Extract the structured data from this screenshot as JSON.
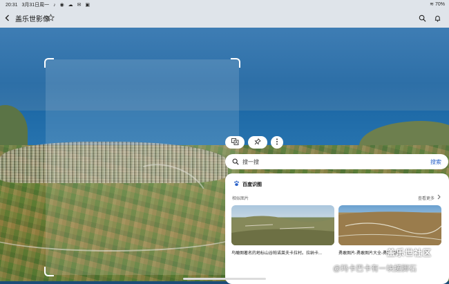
{
  "status_bar": {
    "time": "20:31",
    "date": "3月31日周一",
    "notification_icons": [
      "tiktok-icon",
      "bell-icon",
      "cloud-icon",
      "mail-icon",
      "media-icon"
    ],
    "battery": "70%"
  },
  "app_bar": {
    "title": "盖乐世影像"
  },
  "actions": {
    "icons": [
      "translate-icon",
      "pin-icon",
      "more-vert-icon"
    ]
  },
  "search": {
    "placeholder": "搜一搜",
    "button": "搜索"
  },
  "result_panel": {
    "brand": "百度识图",
    "section_label": "相似图片",
    "more_label": "查看更多",
    "results": [
      {
        "caption": "鸟瞰图著名的地标山谷帕诺莱夫卡拉村。拉纳卡..."
      },
      {
        "caption": "勇敢图片-勇敢图片大全-勇敢图片..."
      }
    ]
  },
  "watermark": {
    "site": "盖乐世社区",
    "author": "@玛卡巴卡有一块搓脚石"
  },
  "colors": {
    "accent": "#2a62c9",
    "bar_bg": "#dfe4ea"
  }
}
